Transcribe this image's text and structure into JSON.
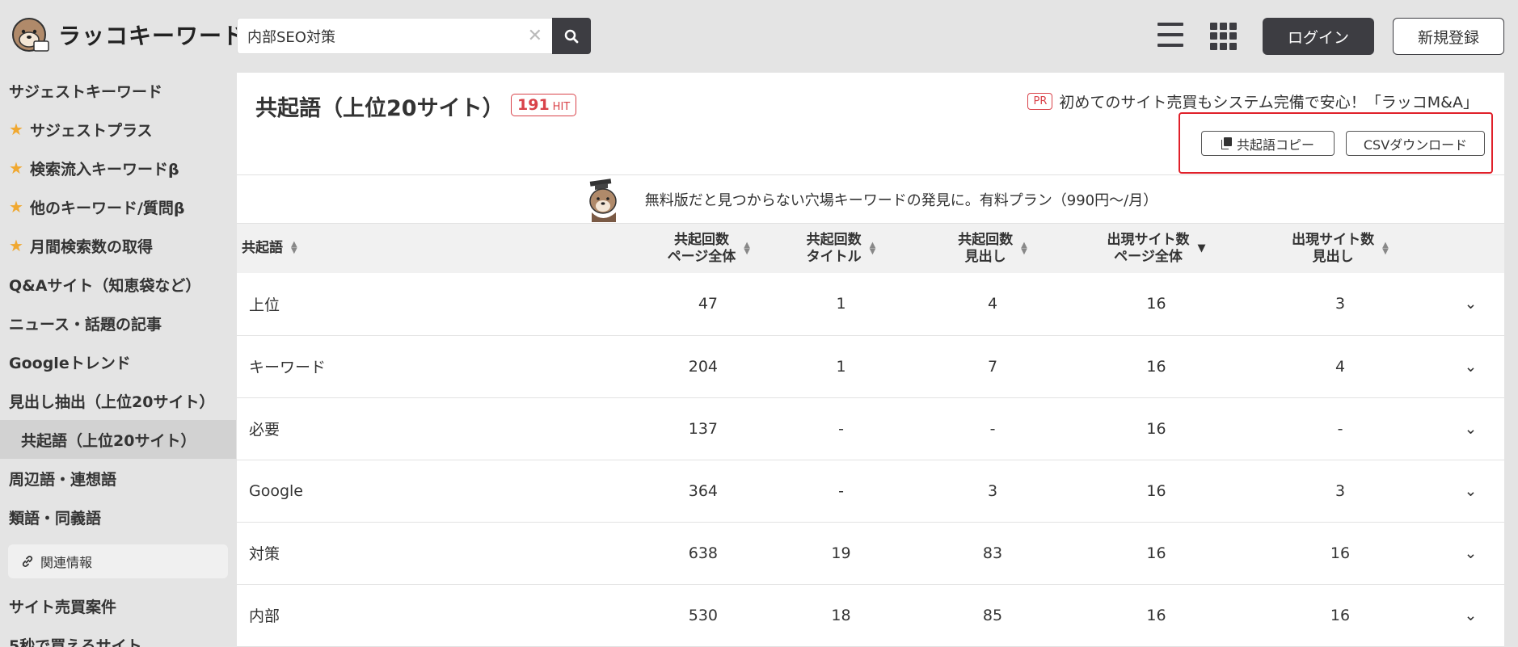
{
  "header": {
    "logo_text": "ラッコキーワード",
    "search": {
      "value": "内部SEO対策",
      "placeholder": ""
    },
    "login_label": "ログイン",
    "register_label": "新規登録"
  },
  "sidebar": {
    "items": [
      {
        "label": "サジェストキーワード",
        "star": false
      },
      {
        "label": "サジェストプラス",
        "star": true
      },
      {
        "label": "検索流入キーワードβ",
        "star": true
      },
      {
        "label": "他のキーワード/質問β",
        "star": true
      },
      {
        "label": "月間検索数の取得",
        "star": true
      },
      {
        "label": "Q&Aサイト（知恵袋など）",
        "star": false
      },
      {
        "label": "ニュース・話題の記事",
        "star": false
      },
      {
        "label": "Googleトレンド",
        "star": false
      },
      {
        "label": "見出し抽出（上位20サイト）",
        "star": false
      },
      {
        "label": "共起語（上位20サイト）",
        "star": false,
        "active": true
      },
      {
        "label": "周辺語・連想語",
        "star": false
      },
      {
        "label": "類語・同義語",
        "star": false
      }
    ],
    "related_label": "関連情報",
    "bottom_items": [
      "サイト売買案件",
      "5秒で買えるサイト"
    ]
  },
  "main": {
    "title": "共起語（上位20サイト）",
    "hit_count": "191",
    "hit_unit": "HIT",
    "pr_badge": "PR",
    "pr_text": "初めてのサイト売買もシステム完備で安心！「ラッコM&A」",
    "copy_label": "共起語コピー",
    "csv_label": "CSVダウンロード",
    "banner_text": "無料版だと見つからない穴場キーワードの発見に。有料プラン（990円〜/月）"
  },
  "table": {
    "headers": [
      {
        "line1": "共起語",
        "line2": ""
      },
      {
        "line1": "共起回数",
        "line2": "ページ全体"
      },
      {
        "line1": "共起回数",
        "line2": "タイトル"
      },
      {
        "line1": "共起回数",
        "line2": "見出し"
      },
      {
        "line1": "出現サイト数",
        "line2": "ページ全体"
      },
      {
        "line1": "出現サイト数",
        "line2": "見出し"
      }
    ],
    "rows": [
      [
        "上位",
        "47",
        "1",
        "4",
        "16",
        "3"
      ],
      [
        "キーワード",
        "204",
        "1",
        "7",
        "16",
        "4"
      ],
      [
        "必要",
        "137",
        "-",
        "-",
        "16",
        "-"
      ],
      [
        "Google",
        "364",
        "-",
        "3",
        "16",
        "3"
      ],
      [
        "対策",
        "638",
        "19",
        "83",
        "16",
        "16"
      ],
      [
        "内部",
        "530",
        "18",
        "85",
        "16",
        "16"
      ]
    ]
  },
  "colors": {
    "accent_dark": "#3d3d42",
    "star": "#f0a830",
    "pr_red": "#d9434a",
    "highlight_box": "#e0202a"
  }
}
